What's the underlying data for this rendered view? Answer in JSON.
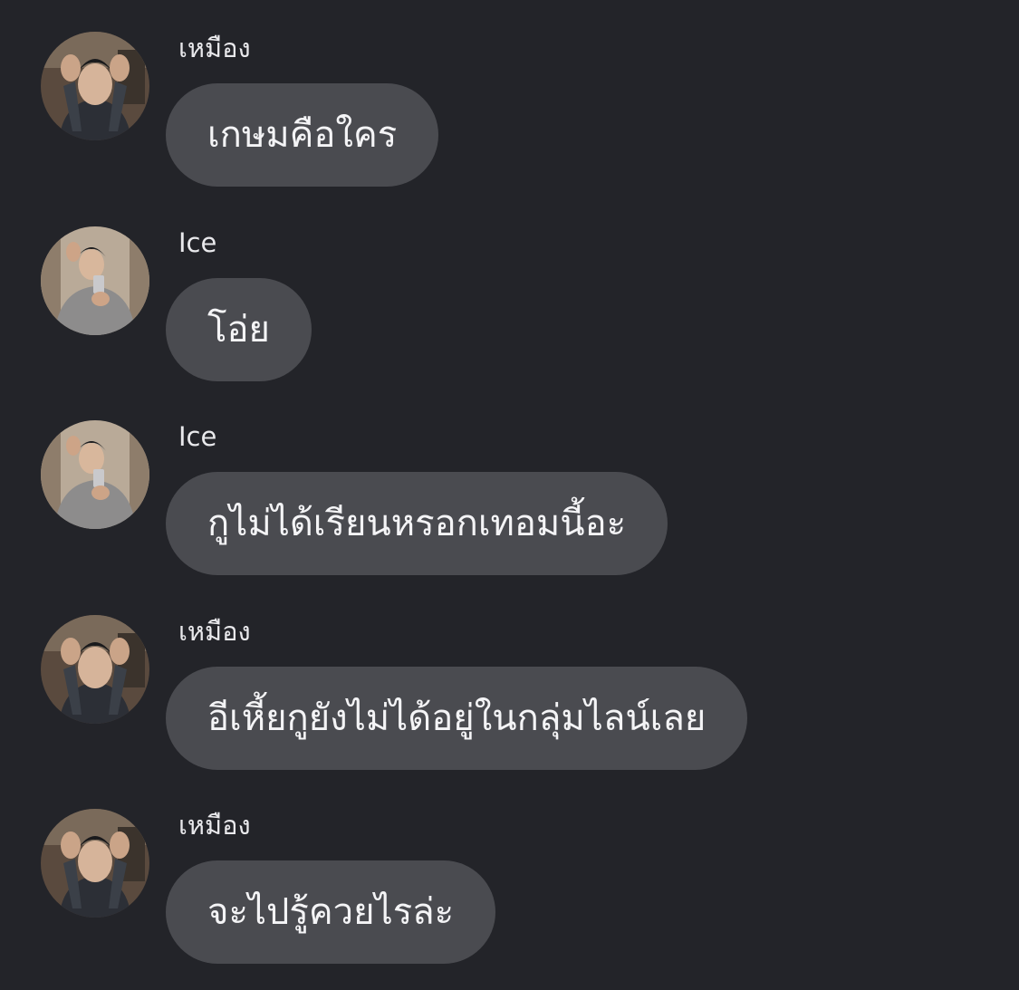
{
  "messages": [
    {
      "sender": "เหมือง",
      "text": "เกษมคือใคร",
      "avatar": "portrait-hands-on-head"
    },
    {
      "sender": "Ice",
      "text": "โอ่ย",
      "avatar": "mirror-selfie-portrait"
    },
    {
      "sender": "Ice",
      "text": "กูไม่ได้เรียนหรอกเทอมนี้อะ",
      "avatar": "mirror-selfie-portrait"
    },
    {
      "sender": "เหมือง",
      "text": "อีเหี้ยกูยังไม่ได้อยู่ในกลุ่มไลน์เลย",
      "avatar": "portrait-hands-on-head"
    },
    {
      "sender": "เหมือง",
      "text": "จะไปรู้ควยไรล่ะ",
      "avatar": "portrait-hands-on-head"
    }
  ],
  "colors": {
    "background": "#232429",
    "bubble": "#4a4b50",
    "text": "#f4f4f6"
  }
}
